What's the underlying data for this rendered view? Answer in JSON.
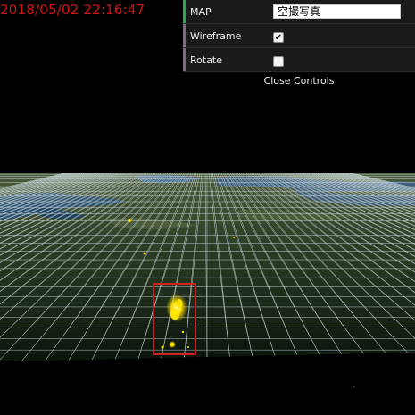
{
  "timestamp": "2018/05/02 22:16:47",
  "controls": {
    "map": {
      "label": "MAP",
      "value": "空撮写真"
    },
    "wireframe": {
      "label": "Wireframe",
      "checked": true,
      "checkmark": "✔"
    },
    "rotate": {
      "label": "Rotate",
      "checked": false,
      "checkmark": ""
    },
    "close_label": "Close Controls"
  },
  "colors": {
    "timestamp": "#d01515",
    "highlight_box": "#d02020",
    "wire": "#d8e4e8",
    "hotspot": "#ffe000"
  }
}
